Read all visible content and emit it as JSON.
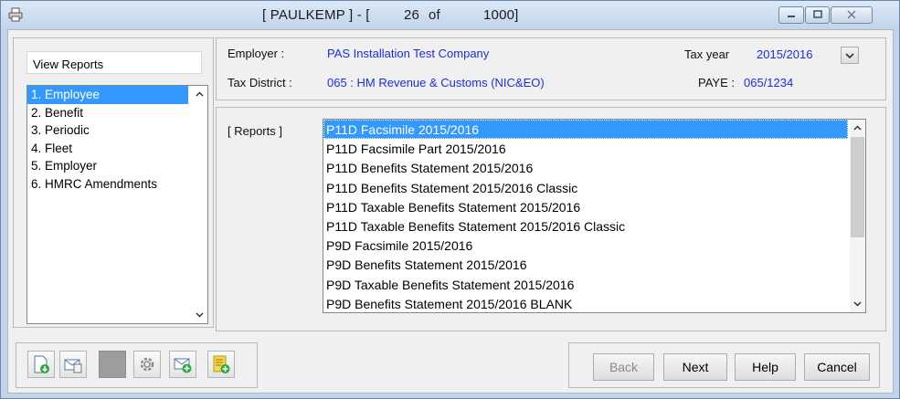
{
  "title": {
    "user": "[ PAULKEMP ] - [",
    "position": "26",
    "of": "of",
    "total": "1000]"
  },
  "left_panel": {
    "view_reports_label": "View Reports",
    "items": [
      {
        "label": "1. Employee",
        "selected": true
      },
      {
        "label": "2. Benefit"
      },
      {
        "label": "3. Periodic"
      },
      {
        "label": "4. Fleet"
      },
      {
        "label": "5. Employer"
      },
      {
        "label": "6. HMRC Amendments"
      }
    ]
  },
  "employer_info": {
    "employer_label": "Employer :",
    "employer_value": "PAS Installation Test Company",
    "tax_district_label": "Tax District :",
    "tax_district_value": "065 : HM Revenue & Customs (NIC&EO)",
    "tax_year_label": "Tax year",
    "tax_year_value": "2015/2016",
    "paye_label": "PAYE :",
    "paye_value": "065/1234"
  },
  "reports": {
    "label": "[ Reports ]",
    "items": [
      "P11D Facsimile 2015/2016",
      "P11D Facsimile Part 2015/2016",
      "P11D Benefits Statement 2015/2016",
      "P11D Benefits Statement 2015/2016 Classic",
      "P11D Taxable Benefits Statement 2015/2016",
      "P11D Taxable Benefits Statement 2015/2016 Classic",
      "P9D Facsimile 2015/2016",
      "P9D Benefits Statement 2015/2016",
      "P9D Taxable Benefits Statement 2015/2016",
      "P9D Benefits Statement 2015/2016 BLANK"
    ],
    "selected_index": 0
  },
  "buttons": {
    "back": "Back",
    "next": "Next",
    "help": "Help",
    "cancel": "Cancel"
  },
  "toolbar_icons": [
    "document-download-icon",
    "mail-document-icon",
    "blank-tool",
    "settings-gear-icon",
    "mail-add-icon",
    "note-add-icon"
  ],
  "colors": {
    "selection": "#3399ff",
    "value_text": "#1a2ee0"
  }
}
